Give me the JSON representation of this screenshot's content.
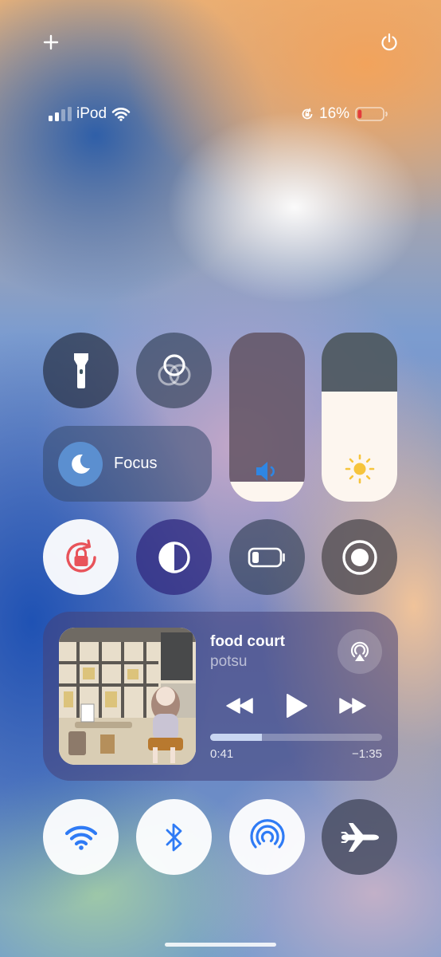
{
  "status_bar": {
    "carrier": "iPod",
    "battery_percent": "16%",
    "battery_level": 0.16,
    "signal_bars": 2
  },
  "toolbar": {
    "add_icon": "plus-icon",
    "power_icon": "power-icon"
  },
  "controls": {
    "flashlight": {
      "icon": "flashlight-icon",
      "active": false
    },
    "screen_mirroring": {
      "icon": "screen-mirroring-icon",
      "active": false
    },
    "focus": {
      "label": "Focus",
      "icon": "moon-icon"
    },
    "volume": {
      "icon": "speaker-icon",
      "level": 0.12
    },
    "brightness": {
      "icon": "sun-icon",
      "level": 0.65
    },
    "orientation_lock": {
      "icon": "rotation-lock-icon",
      "active": true
    },
    "dark_mode": {
      "icon": "dark-mode-icon"
    },
    "low_power": {
      "icon": "battery-icon"
    },
    "screen_recording": {
      "icon": "record-icon"
    }
  },
  "now_playing": {
    "title": "food court",
    "artist": "potsu",
    "elapsed": "0:41",
    "remaining": "−1:35",
    "progress": 0.3
  },
  "connectivity": {
    "wifi": {
      "icon": "wifi-icon",
      "active": true
    },
    "bluetooth": {
      "icon": "bluetooth-icon",
      "active": true
    },
    "airdrop": {
      "icon": "airdrop-icon",
      "active": true
    },
    "airplane_mode": {
      "icon": "airplane-icon",
      "active": false
    }
  },
  "colors": {
    "accent_blue": "#2f7bf5",
    "lock_red": "#e8535a",
    "battery_red": "#e33b3b",
    "sun_yellow": "#f6c43c"
  }
}
